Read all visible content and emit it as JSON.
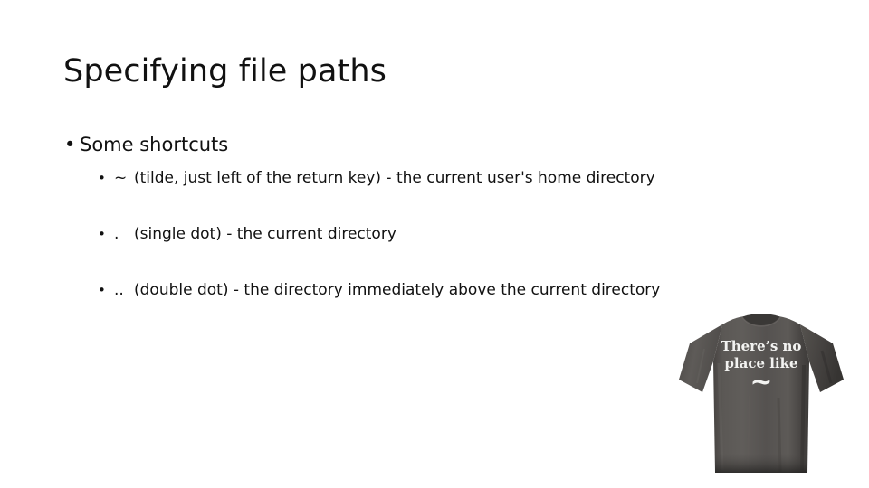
{
  "slide": {
    "title": "Specifying file paths",
    "background_color": "#ffffff",
    "text_color": "#111111"
  },
  "body": {
    "level1": {
      "bullet_glyph": "•",
      "text": "Some shortcuts"
    },
    "items": [
      {
        "bullet_glyph": "•",
        "shortcut": "~",
        "description": "(tilde, just left of the return key) - the current user's home directory"
      },
      {
        "bullet_glyph": "•",
        "shortcut": ".",
        "description": "(single dot) - the current directory"
      },
      {
        "bullet_glyph": "•",
        "shortcut": "..",
        "description": "(double dot) - the directory immediately above the current directory"
      }
    ]
  },
  "tshirt": {
    "alt": "dark gray t-shirt",
    "fabric_color": "#565350",
    "fabric_shadow_color": "#3e3b39",
    "print_color": "#f3f3f1",
    "line1": "There’s no",
    "line2": "place like",
    "line3": "~"
  }
}
